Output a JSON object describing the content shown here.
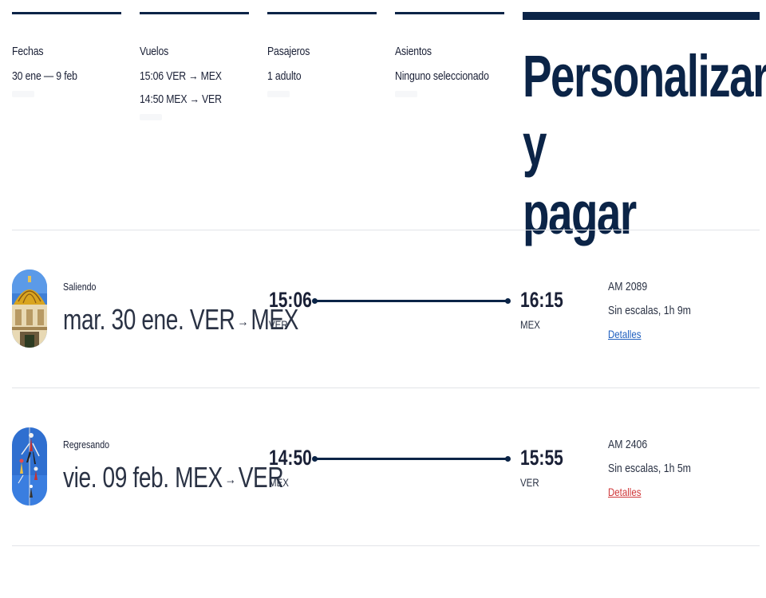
{
  "steps": [
    {
      "title": "Fechas",
      "lines": [
        "30 ene — 9 feb"
      ]
    },
    {
      "title": "Vuelos",
      "lines": [
        "15:06 VER → MEX",
        "14:50 MEX → VER"
      ]
    },
    {
      "title": "Pasajeros",
      "lines": [
        "1 adulto"
      ]
    },
    {
      "title": "Asientos",
      "lines": [
        "Ninguno seleccionado"
      ]
    }
  ],
  "current_step": {
    "title_line1": "Personalizar y",
    "title_line2": "pagar"
  },
  "flights": [
    {
      "direction": "Saliendo",
      "date": "mar. 30 ene.",
      "origin": "VER",
      "destination": "MEX",
      "route_arrow": "→",
      "depart_time": "15:06",
      "depart_airport": "VER",
      "arrive_time": "16:15",
      "arrive_airport": "MEX",
      "flight_number": "AM 2089",
      "stops": "Sin escalas, 1h 9m",
      "details_label": "Detalles",
      "details_color": "#1f5fbf",
      "image": "dome-photo"
    },
    {
      "direction": "Regresando",
      "date": "vie. 09 feb.",
      "origin": "MEX",
      "destination": "VER",
      "route_arrow": "→",
      "depart_time": "14:50",
      "depart_airport": "MEX",
      "arrive_time": "15:55",
      "arrive_airport": "VER",
      "flight_number": "AM 2406",
      "stops": "Sin escalas, 1h 5m",
      "details_label": "Detalles",
      "details_color": "#d0383a",
      "image": "voladores-photo"
    }
  ],
  "colors": {
    "brand_navy": "#0b2447",
    "divider": "#e2e4e8"
  }
}
